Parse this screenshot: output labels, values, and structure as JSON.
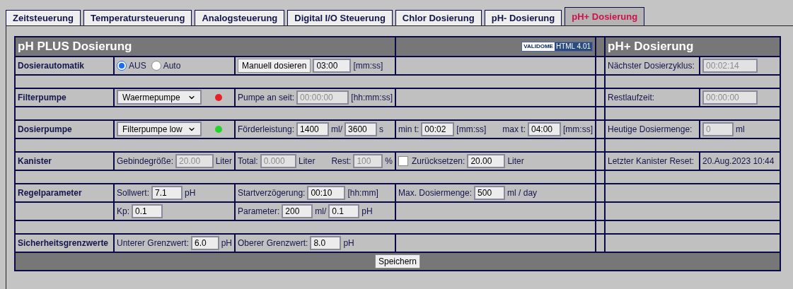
{
  "tabs": [
    {
      "label": "Zeitsteuerung",
      "selected": false
    },
    {
      "label": "Temperatursteuerung",
      "selected": false
    },
    {
      "label": "Analogsteuerung",
      "selected": false
    },
    {
      "label": "Digital I/O Steuerung",
      "selected": false
    },
    {
      "label": "Chlor Dosierung",
      "selected": false
    },
    {
      "label": "pH- Dosierung",
      "selected": false
    },
    {
      "label": "pH+ Dosierung",
      "selected": true
    }
  ],
  "panel": {
    "title": "pH PLUS Dosierung",
    "badge": {
      "brand": "VALIDOME",
      "label": "HTML 4.01"
    },
    "side_title": "pH+ Dosierung",
    "rows": [
      {
        "kind": "row",
        "label": "Dosierautomatik",
        "cells": [
          [
            {
              "kind": "radio",
              "label": "AUS",
              "selected": true
            },
            {
              "kind": "radio",
              "label": "Auto",
              "selected": false
            }
          ],
          [
            {
              "kind": "button",
              "label": "Manuell dosieren"
            },
            {
              "kind": "input",
              "value": "03:00",
              "disabled": false
            },
            {
              "kind": "text",
              "text": "[mm:ss]"
            }
          ],
          []
        ],
        "side": {
          "kind": "pair",
          "label": "Nächster Dosierzyklus:",
          "items": [
            {
              "kind": "input",
              "value": "00:02:14",
              "disabled": true
            }
          ]
        }
      },
      {
        "kind": "spacer"
      },
      {
        "kind": "row",
        "label": "Filterpumpe",
        "cells": [
          [
            {
              "kind": "select",
              "value": "Waermepumpe"
            },
            {
              "kind": "led",
              "color": "#e8202a"
            }
          ],
          [
            {
              "kind": "text",
              "text": "Pumpe an seit:"
            },
            {
              "kind": "input",
              "value": "00:00:00",
              "disabled": true
            },
            {
              "kind": "text",
              "text": "[hh:mm:ss]"
            }
          ],
          []
        ],
        "side": {
          "kind": "pair",
          "label": "Restlaufzeit:",
          "items": [
            {
              "kind": "input",
              "value": "00:00:00",
              "disabled": true
            }
          ]
        }
      },
      {
        "kind": "spacer"
      },
      {
        "kind": "row",
        "label": "Dosierpumpe",
        "cells": [
          [
            {
              "kind": "select",
              "value": "Filterpumpe low"
            },
            {
              "kind": "led",
              "color": "#22d42a"
            }
          ],
          [
            {
              "kind": "text",
              "text": "Förderleistung:"
            },
            {
              "kind": "input",
              "value": "1400",
              "disabled": false
            },
            {
              "kind": "text",
              "text": "ml/"
            },
            {
              "kind": "input",
              "value": "3600",
              "disabled": false
            },
            {
              "kind": "text",
              "text": "s"
            }
          ],
          [
            {
              "kind": "text",
              "text": "min t:"
            },
            {
              "kind": "input",
              "value": "00:02",
              "disabled": false
            },
            {
              "kind": "text",
              "text": "[mm:ss]"
            },
            {
              "kind": "text",
              "text": "max t:",
              "spaced": true
            },
            {
              "kind": "input",
              "value": "04:00",
              "disabled": false
            },
            {
              "kind": "text",
              "text": "[mm:ss]"
            }
          ]
        ],
        "side": {
          "kind": "pair",
          "label": "Heutige Dosiermenge:",
          "items": [
            {
              "kind": "input",
              "value": "0",
              "disabled": true
            },
            {
              "kind": "text",
              "text": "ml"
            }
          ]
        }
      },
      {
        "kind": "spacer"
      },
      {
        "kind": "row",
        "label": "Kanister",
        "cells": [
          [
            {
              "kind": "text",
              "text": "Gebindegröße:"
            },
            {
              "kind": "input",
              "value": "20.00",
              "disabled": true
            },
            {
              "kind": "text",
              "text": "Liter"
            }
          ],
          [
            {
              "kind": "text",
              "text": "Total:"
            },
            {
              "kind": "input",
              "value": "0.000",
              "disabled": true
            },
            {
              "kind": "text",
              "text": "Liter"
            },
            {
              "kind": "text",
              "text": "Rest:",
              "spaced": true
            },
            {
              "kind": "input",
              "value": "100",
              "disabled": true
            },
            {
              "kind": "text",
              "text": "%"
            }
          ],
          [
            {
              "kind": "checkbox",
              "checked": false
            },
            {
              "kind": "text",
              "text": "Zurücksetzen:"
            },
            {
              "kind": "input",
              "value": "20.00",
              "disabled": false
            },
            {
              "kind": "text",
              "text": "Liter"
            }
          ]
        ],
        "side": {
          "kind": "pair",
          "label": "Letzter Kanister Reset:",
          "items": [
            {
              "kind": "text",
              "text": "20.Aug.2023 10:44"
            }
          ]
        }
      },
      {
        "kind": "spacer"
      },
      {
        "kind": "row",
        "label": "Regelparameter",
        "cells": [
          [
            {
              "kind": "text",
              "text": "Sollwert:"
            },
            {
              "kind": "input",
              "value": "7.1",
              "disabled": false
            },
            {
              "kind": "text",
              "text": "pH"
            }
          ],
          [
            {
              "kind": "text",
              "text": "Startverzögerung:"
            },
            {
              "kind": "input",
              "value": "00:10",
              "disabled": false
            },
            {
              "kind": "text",
              "text": "[hh:mm]"
            }
          ],
          [
            {
              "kind": "text",
              "text": "Max. Dosiermenge:"
            },
            {
              "kind": "input",
              "value": "500",
              "disabled": false
            },
            {
              "kind": "text",
              "text": "ml / day"
            }
          ]
        ],
        "side": {
          "kind": "empty"
        }
      },
      {
        "kind": "row",
        "cells": [
          [
            {
              "kind": "text",
              "text": "Kp:"
            },
            {
              "kind": "input",
              "value": "0.1",
              "disabled": false
            }
          ],
          [
            {
              "kind": "text",
              "text": "Parameter:"
            },
            {
              "kind": "input",
              "value": "200",
              "disabled": false
            },
            {
              "kind": "text",
              "text": "ml/"
            },
            {
              "kind": "input",
              "value": "0.1",
              "disabled": false
            },
            {
              "kind": "text",
              "text": "pH"
            }
          ],
          []
        ],
        "side": {
          "kind": "empty"
        }
      },
      {
        "kind": "spacer"
      },
      {
        "kind": "row",
        "label": "Sicherheitsgrenzwerte",
        "cells": [
          [
            {
              "kind": "text",
              "text": "Unterer Grenzwert:"
            },
            {
              "kind": "input",
              "value": "6.0",
              "disabled": false
            },
            {
              "kind": "text",
              "text": "pH"
            }
          ],
          [
            {
              "kind": "text",
              "text": "Oberer Grenzwert:"
            },
            {
              "kind": "input",
              "value": "8.0",
              "disabled": false
            },
            {
              "kind": "text",
              "text": "pH"
            }
          ],
          []
        ],
        "side": {
          "kind": "empty"
        }
      }
    ],
    "save_button": "Speichern"
  }
}
